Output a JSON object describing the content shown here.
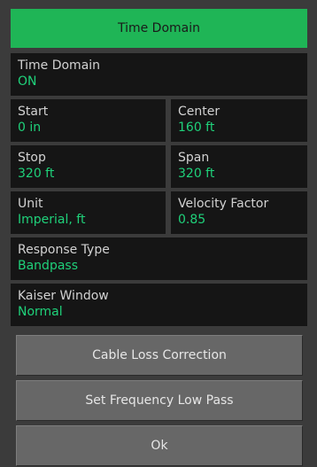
{
  "header": {
    "title": "Time Domain"
  },
  "fields": {
    "time_domain": {
      "label": "Time Domain",
      "value": "ON"
    },
    "start": {
      "label": "Start",
      "value": "0 in"
    },
    "center": {
      "label": "Center",
      "value": "160 ft"
    },
    "stop": {
      "label": "Stop",
      "value": "320 ft"
    },
    "span": {
      "label": "Span",
      "value": "320 ft"
    },
    "unit": {
      "label": "Unit",
      "value": "Imperial, ft"
    },
    "velocity_factor": {
      "label": "Velocity Factor",
      "value": "0.85"
    },
    "response_type": {
      "label": "Response Type",
      "value": "Bandpass"
    },
    "kaiser_window": {
      "label": "Kaiser Window",
      "value": "Normal"
    }
  },
  "buttons": {
    "cable_loss": "Cable Loss Correction",
    "low_pass": "Set Frequency Low Pass",
    "ok": "Ok"
  },
  "colors": {
    "accent": "#1fb556",
    "value_text": "#1fd17a",
    "panel_bg": "#3b3b3b",
    "cell_bg": "#151515",
    "button_bg": "#676767"
  }
}
